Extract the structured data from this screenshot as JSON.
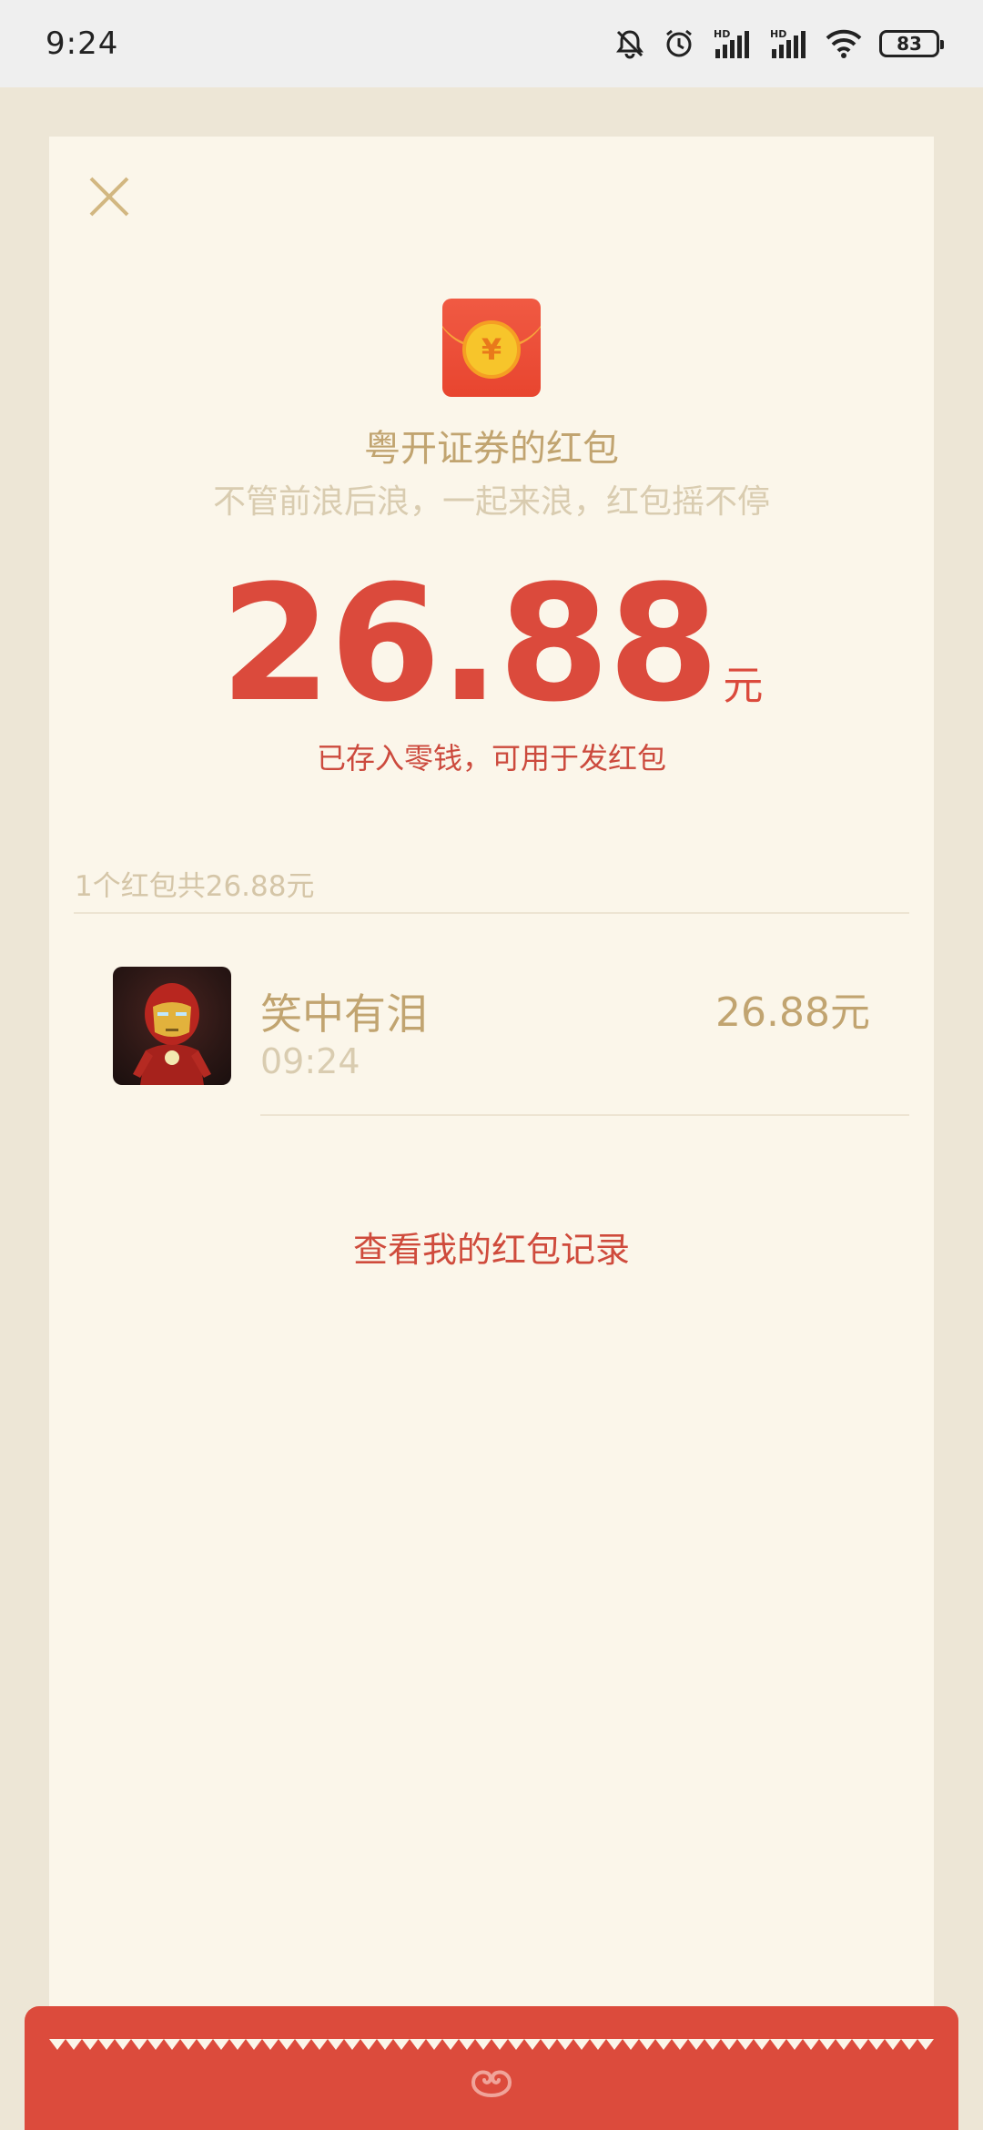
{
  "status_bar": {
    "time": "9:24",
    "battery": "83",
    "icons": [
      "bell-muted-icon",
      "alarm-icon",
      "signal-hd-icon",
      "signal-hd-icon",
      "wifi-icon",
      "battery-icon"
    ],
    "hd_label": "HD"
  },
  "card": {
    "sender_title": "粤开证券的红包",
    "wish": "不管前浪后浪，一起来浪，红包摇不停",
    "amount": "26.88",
    "amount_unit": "元",
    "saved_note": "已存入零钱，可用于发红包",
    "summary": "1个红包共26.88元",
    "coin_symbol": "¥"
  },
  "recipients": [
    {
      "name": "笑中有泪",
      "time": "09:24",
      "amount": "26.88元"
    }
  ],
  "history_link": "查看我的红包记录",
  "colors": {
    "accent_red": "#db4a3c",
    "gold_text": "#c1a470",
    "card_bg": "#fbf6ea",
    "page_bg": "#ede6d6"
  }
}
